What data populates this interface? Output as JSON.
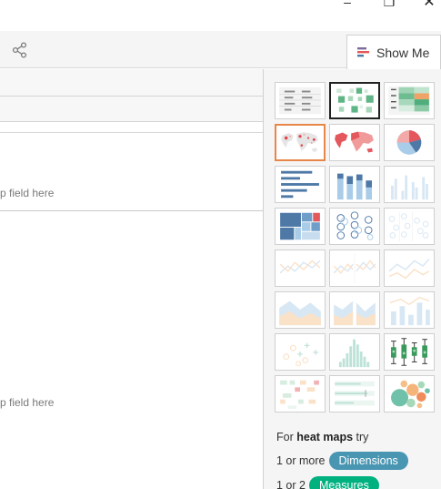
{
  "window": {
    "minimize_glyph": "–",
    "maximize_glyph": "❐",
    "close_glyph": "✕"
  },
  "toolbar": {
    "share_icon": "share-icon"
  },
  "showme": {
    "tab_label": "Show Me",
    "tab_icon": "show-me-icon"
  },
  "view": {
    "drop_hint_top": "p field here",
    "drop_hint_bottom": "p field here"
  },
  "chart_types": [
    {
      "name": "text-table",
      "state": "enabled"
    },
    {
      "name": "heat-map",
      "state": "selected"
    },
    {
      "name": "highlight-table",
      "state": "enabled"
    },
    {
      "name": "symbol-map",
      "state": "hover"
    },
    {
      "name": "filled-map",
      "state": "enabled"
    },
    {
      "name": "pie-chart",
      "state": "enabled"
    },
    {
      "name": "horizontal-bars",
      "state": "enabled"
    },
    {
      "name": "stacked-bars",
      "state": "enabled"
    },
    {
      "name": "side-by-side-bars",
      "state": "disabled"
    },
    {
      "name": "treemap",
      "state": "enabled"
    },
    {
      "name": "circle-views",
      "state": "enabled"
    },
    {
      "name": "side-by-side-circles",
      "state": "disabled"
    },
    {
      "name": "continuous-lines",
      "state": "disabled"
    },
    {
      "name": "discrete-lines",
      "state": "disabled"
    },
    {
      "name": "dual-lines",
      "state": "disabled"
    },
    {
      "name": "area-continuous",
      "state": "disabled"
    },
    {
      "name": "area-discrete",
      "state": "disabled"
    },
    {
      "name": "dual-combination",
      "state": "disabled"
    },
    {
      "name": "scatter-plot",
      "state": "disabled"
    },
    {
      "name": "histogram",
      "state": "disabled"
    },
    {
      "name": "box-and-whisker",
      "state": "enabled"
    },
    {
      "name": "gantt-chart",
      "state": "disabled"
    },
    {
      "name": "bullet-graph",
      "state": "disabled"
    },
    {
      "name": "packed-bubbles",
      "state": "enabled"
    }
  ],
  "hint": {
    "prefix": "For ",
    "chart_name": "heat maps",
    "suffix": " try",
    "dimensions_prefix": "1 or more",
    "dimensions_label": "Dimensions",
    "measures_prefix": "1 or 2",
    "measures_label": "Measures"
  },
  "colors": {
    "dimension_pill": "#4996b2",
    "measure_pill": "#00b180",
    "selected_border": "#222222",
    "hover_border": "#e8864a"
  }
}
